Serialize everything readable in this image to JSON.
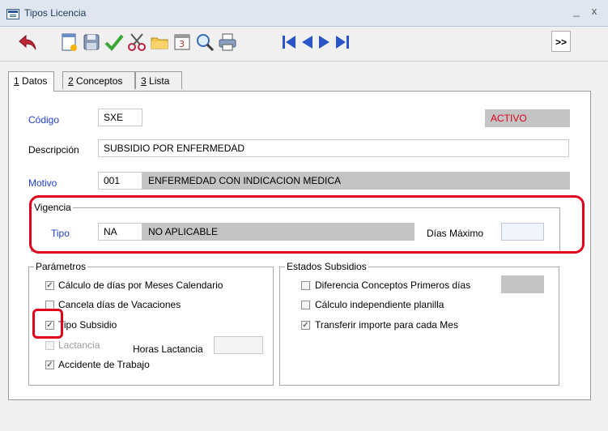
{
  "window": {
    "title": "Tipos Licencia",
    "minimize": "_",
    "close": "x"
  },
  "toolbar": {
    "icons": [
      "undo-icon",
      "new-document-icon",
      "save-icon",
      "check-icon",
      "scissors-icon",
      "folder-icon",
      "calendar-icon",
      "search-icon",
      "print-icon",
      "first-record-icon",
      "previous-record-icon",
      "next-record-icon",
      "last-record-icon"
    ],
    "more_label": ">>"
  },
  "tabs": [
    {
      "num": "1",
      "label": " Datos"
    },
    {
      "num": "2",
      "label": " Conceptos"
    },
    {
      "num": "3",
      "label": " Lista"
    }
  ],
  "form": {
    "codigo": {
      "label": "Código",
      "value": "SXE"
    },
    "status": "ACTIVO",
    "descripcion": {
      "label": "Descripción",
      "value": "SUBSIDIO POR ENFERMEDAD"
    },
    "motivo": {
      "label": "Motivo",
      "code": "001",
      "desc": "ENFERMEDAD CON  INDICACION MEDICA"
    }
  },
  "vigencia": {
    "legend": "Vigencia",
    "tipo_label": "Tipo",
    "tipo_code": "NA",
    "tipo_desc": "NO APLICABLE",
    "dias_max_label": "Días Máximo",
    "dias_max_value": ""
  },
  "parametros": {
    "legend": "Parámetros",
    "items": [
      {
        "label": "Cálculo de días por Meses Calendario",
        "checked": true
      },
      {
        "label": "Cancela días de Vacaciones",
        "checked": false
      },
      {
        "label": "Tipo Subsidio",
        "checked": true
      },
      {
        "label": "Lactancia",
        "checked": false
      },
      {
        "label": "Accidente de Trabajo",
        "checked": true
      }
    ],
    "horas_lactancia_label": "Horas Lactancia",
    "horas_lactancia_value": ""
  },
  "estados": {
    "legend": "Estados Subsidios",
    "items": [
      {
        "label": "Diferencia Conceptos Primeros días",
        "checked": false
      },
      {
        "label": "Cálculo independiente planilla",
        "checked": false
      },
      {
        "label": "Transferir importe para cada Mes",
        "checked": true
      }
    ],
    "diferencia_value": ""
  },
  "colors": {
    "highlight": "#e0001a",
    "label_blue": "#1e3fc8",
    "status_red": "#e0001a",
    "readonly_gray": "#c4c4c4"
  }
}
